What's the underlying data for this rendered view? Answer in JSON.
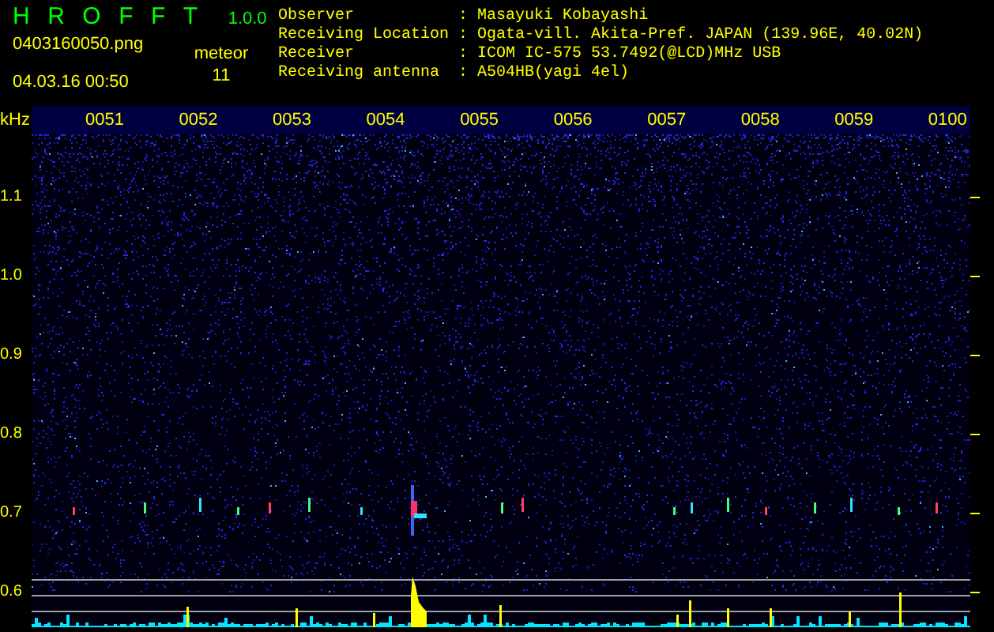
{
  "app": {
    "title": "HROFFT",
    "version": "1.0.0"
  },
  "file": {
    "name": "0403160050.png",
    "datetime": "04.03.16 00:50"
  },
  "meteor": {
    "label": "meteor",
    "count": "11"
  },
  "info": [
    {
      "label": "Observer",
      "separator": ":",
      "value": "Masayuki Kobayashi"
    },
    {
      "label": "Receiving Location",
      "separator": ":",
      "value": "Ogata-vill. Akita-Pref. JAPAN (139.96E, 40.02N)"
    },
    {
      "label": "Receiver",
      "separator": ":",
      "value": "ICOM IC-575 53.7492(@LCD)MHz USB"
    },
    {
      "label": "Receiving antenna",
      "separator": ":",
      "value": "A504HB(yagi 4el)"
    }
  ],
  "axis": {
    "unit": "kHz",
    "frequencies": [
      "1.1",
      "1.0",
      "0.9",
      "0.8",
      "0.7",
      "0.6"
    ],
    "times": [
      "0051",
      "0052",
      "0053",
      "0054",
      "0055",
      "0056",
      "0057",
      "0058",
      "0059",
      "0100"
    ]
  }
}
